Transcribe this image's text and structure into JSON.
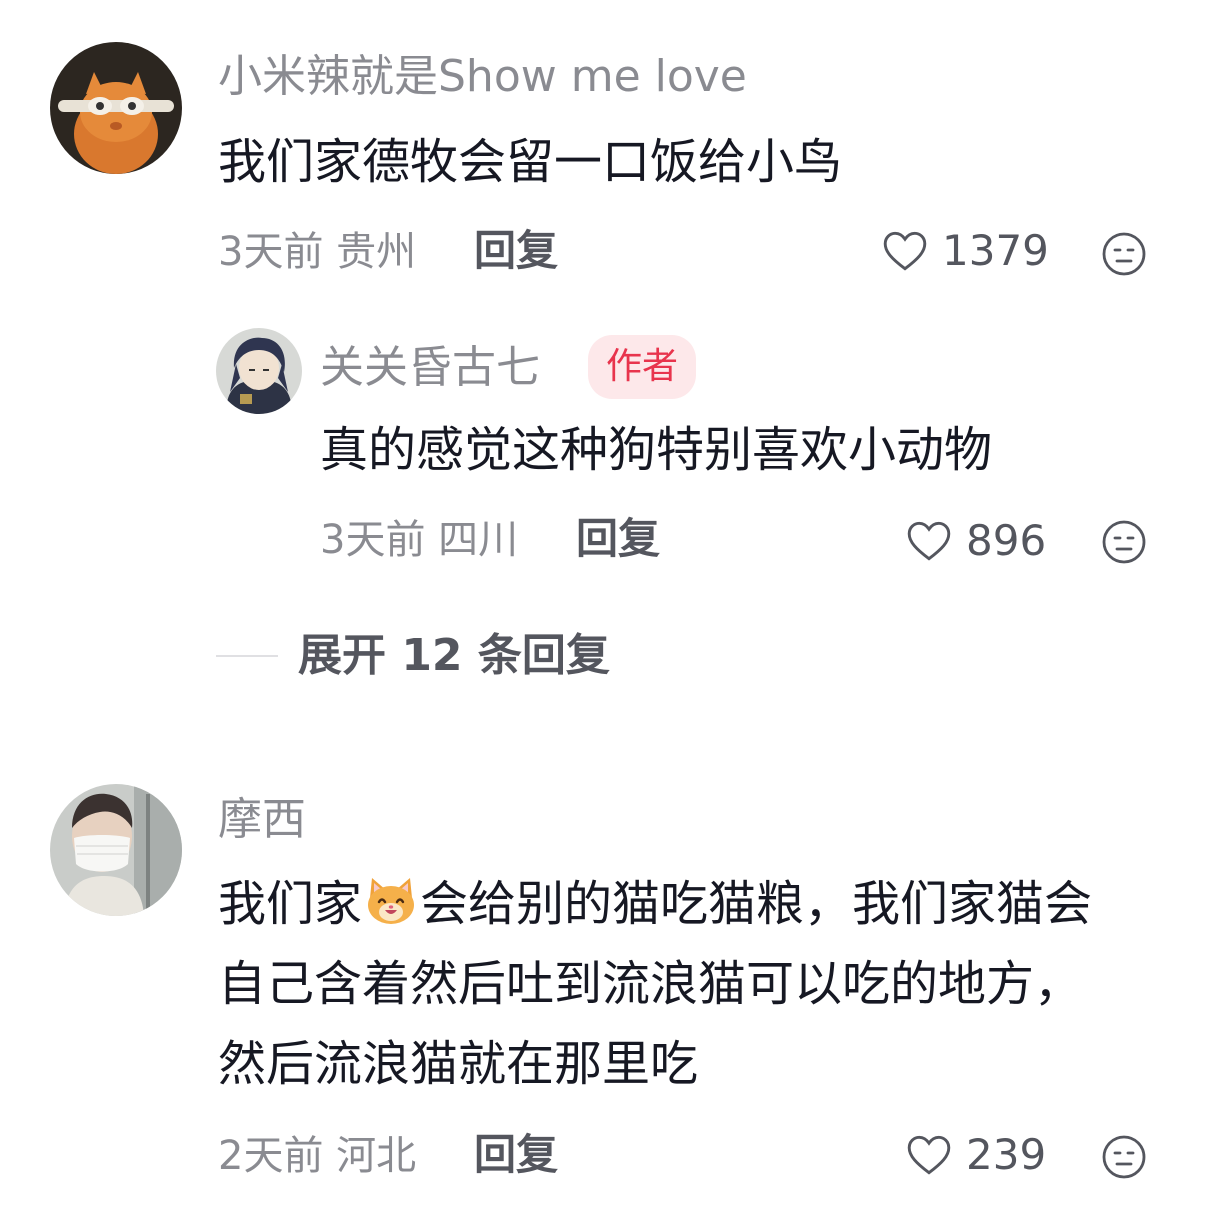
{
  "comments": [
    {
      "username": "小米辣就是Show me love",
      "text": "我们家德牧会留一口饭给小鸟",
      "time_location": "3天前 贵州",
      "reply_label": "回复",
      "likes": "1379"
    },
    {
      "username": "摩西",
      "text_line1_before": "我们家",
      "text_line1_after": "会给别的猫吃猫粮，我们家猫会",
      "text_line2": "自己含着然后吐到流浪猫可以吃的地方，",
      "text_line3": "然后流浪猫就在那里吃",
      "time_location": "2天前 河北",
      "reply_label": "回复",
      "likes": "239"
    }
  ],
  "reply": {
    "username": "关关昏古七",
    "badge": "作者",
    "text": "真的感觉这种狗特别喜欢小动物",
    "time_location": "3天前 四川",
    "reply_label": "回复",
    "likes": "896"
  },
  "expand_replies_label": "展开 12 条回复",
  "colors": {
    "text_primary": "#161823",
    "text_secondary": "#8a8b91",
    "badge_bg": "#fde8ea",
    "badge_text": "#e8344d"
  },
  "icons": [
    "heart-icon",
    "dislike-face-icon",
    "cat-face-emoji"
  ]
}
